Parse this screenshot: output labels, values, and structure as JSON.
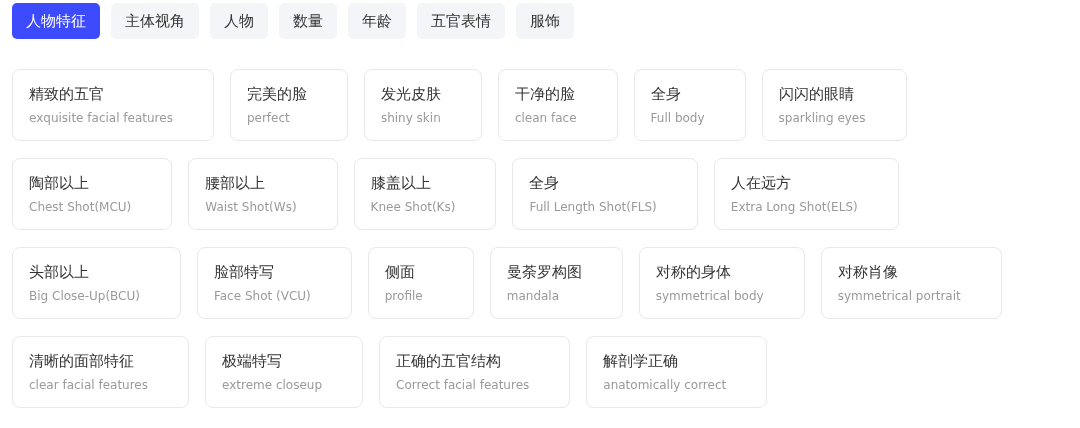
{
  "tabs": [
    {
      "label": "人物特征",
      "selected": true
    },
    {
      "label": "主体视角",
      "selected": false
    },
    {
      "label": "人物",
      "selected": false
    },
    {
      "label": "数量",
      "selected": false
    },
    {
      "label": "年龄",
      "selected": false
    },
    {
      "label": "五官表情",
      "selected": false
    },
    {
      "label": "服饰",
      "selected": false
    }
  ],
  "rows": [
    [
      {
        "title": "精致的五官",
        "subtitle": "exquisite facial features"
      },
      {
        "title": "完美的脸",
        "subtitle": "perfect"
      },
      {
        "title": "发光皮肤",
        "subtitle": "shiny skin"
      },
      {
        "title": "干净的脸",
        "subtitle": "clean face"
      },
      {
        "title": "全身",
        "subtitle": "Full body"
      },
      {
        "title": "闪闪的眼睛",
        "subtitle": "sparkling eyes"
      }
    ],
    [
      {
        "title": "陶部以上",
        "subtitle": "Chest Shot(MCU)"
      },
      {
        "title": "腰部以上",
        "subtitle": "Waist Shot(Ws)"
      },
      {
        "title": "膝盖以上",
        "subtitle": "Knee Shot(Ks)"
      },
      {
        "title": "全身",
        "subtitle": "Full Length Shot(FLS)"
      },
      {
        "title": "人在远方",
        "subtitle": "Extra Long Shot(ELS)"
      }
    ],
    [
      {
        "title": "头部以上",
        "subtitle": "Big Close-Up(BCU)"
      },
      {
        "title": "脸部特写",
        "subtitle": "Face Shot (VCU)"
      },
      {
        "title": "侧面",
        "subtitle": "profile"
      },
      {
        "title": "曼荼罗构图",
        "subtitle": "mandala"
      },
      {
        "title": "对称的身体",
        "subtitle": "symmetrical body"
      },
      {
        "title": "对称肖像",
        "subtitle": "symmetrical portrait"
      }
    ],
    [
      {
        "title": "清晰的面部特征",
        "subtitle": "clear facial features"
      },
      {
        "title": "极端特写",
        "subtitle": "extreme closeup"
      },
      {
        "title": "正确的五官结构",
        "subtitle": "Correct facial features"
      },
      {
        "title": "解剖学正确",
        "subtitle": "anatomically correct"
      }
    ]
  ]
}
